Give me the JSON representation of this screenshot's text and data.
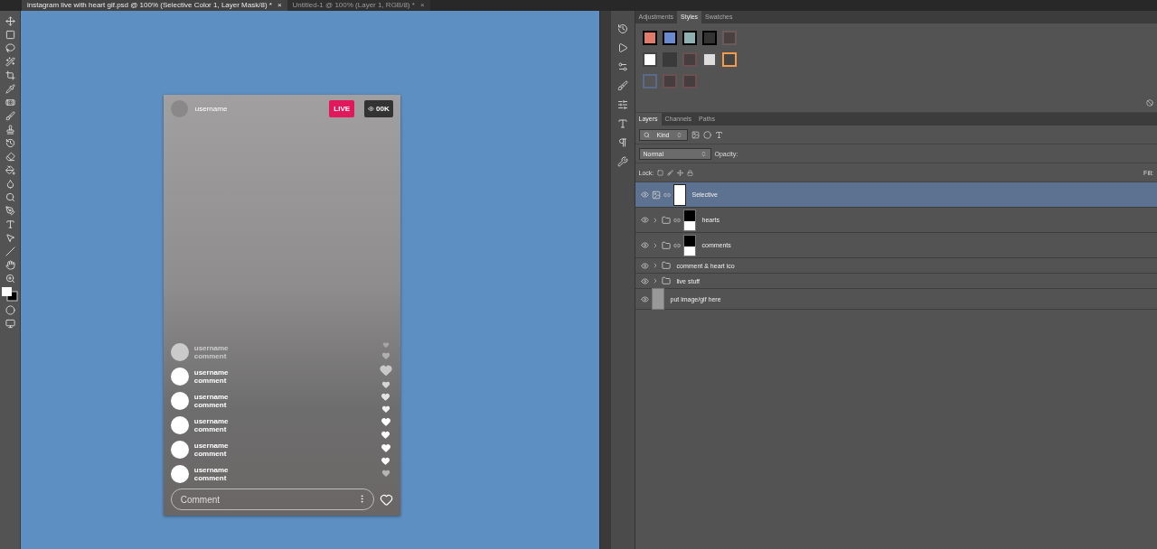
{
  "document_tabs": [
    {
      "label": "instagram live with heart gif.psd @ 100% (Selective Color 1, Layer Mask/8) *",
      "selected": true,
      "close": "×"
    },
    {
      "label": "Untitled-1 @ 100% (Layer 1, RGB/8) *",
      "selected": false,
      "close": "×"
    }
  ],
  "post": {
    "username": "username",
    "live_badge": "LIVE",
    "viewers": "00K",
    "comments": [
      {
        "username": "username",
        "comment": "comment",
        "faded": true
      },
      {
        "username": "username",
        "comment": "comment",
        "faded": false
      },
      {
        "username": "username",
        "comment": "comment",
        "faded": false
      },
      {
        "username": "username",
        "comment": "comment",
        "faded": false
      },
      {
        "username": "username",
        "comment": "comment",
        "faded": false
      },
      {
        "username": "username",
        "comment": "comment",
        "faded": false
      }
    ],
    "comment_field": {
      "placeholder": "Comment"
    }
  },
  "style_tabs": [
    {
      "label": "Adjustments",
      "selected": false
    },
    {
      "label": "Styles",
      "selected": true
    },
    {
      "label": "Swatches",
      "selected": false
    }
  ],
  "layers_panel": {
    "tabs": [
      {
        "label": "Layers",
        "selected": true
      },
      {
        "label": "Channels",
        "selected": false
      },
      {
        "label": "Paths",
        "selected": false
      }
    ],
    "filter": "Kind",
    "blend_mode": "Normal",
    "opacity_label": "Opacity:",
    "lock_label": "Lock:",
    "fill_label": "Fill:",
    "layers": [
      {
        "name": "Selective",
        "kind": "adjustment",
        "selected": true
      },
      {
        "name": "hearts",
        "kind": "masked-group",
        "selected": false
      },
      {
        "name": "comments",
        "kind": "masked-group",
        "selected": false
      },
      {
        "name": "comment & heart ico",
        "kind": "group",
        "selected": false
      },
      {
        "name": "live stuff",
        "kind": "group",
        "selected": false
      },
      {
        "name": "put image/gif here",
        "kind": "image",
        "selected": false
      }
    ]
  }
}
